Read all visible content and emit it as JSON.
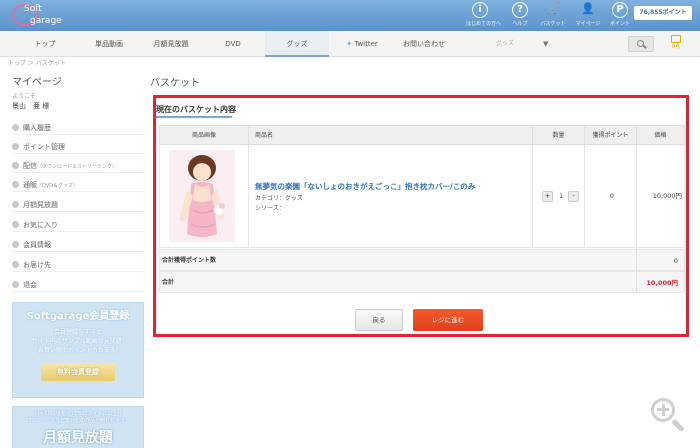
{
  "header": {
    "logo_top": "Soft",
    "logo_bottom": "garage",
    "icons": [
      {
        "name": "guide-icon",
        "symbol": "i",
        "label": "はじめての方へ"
      },
      {
        "name": "help-icon",
        "symbol": "?",
        "label": "ヘルプ"
      },
      {
        "name": "cart-icon",
        "symbol": "🛒",
        "label": "バスケット"
      },
      {
        "name": "mypage-icon",
        "symbol": "👤",
        "label": "マイページ"
      },
      {
        "name": "point-icon",
        "symbol": "P",
        "label": "ポイント"
      }
    ],
    "points_display": "76,855ポイント"
  },
  "nav": {
    "items": [
      "トップ",
      "単品動画",
      "月額見放題",
      "DVD",
      "グッズ",
      "Twitter",
      "お問い合わせ"
    ],
    "search_category": "グッズ",
    "cart_mini_label": "0点"
  },
  "breadcrumb": "トップ ＞ バスケット",
  "sidebar": {
    "title": "マイページ",
    "user_label": "ようこそ",
    "user_name": "景山　亜 様",
    "items": [
      {
        "label": "購入履歴",
        "sub": ""
      },
      {
        "label": "ポイント管理",
        "sub": ""
      },
      {
        "label": "配信",
        "sub": "（ダウンロード＆ストリーミング）"
      },
      {
        "label": "通販",
        "sub": "（DVD＆グッズ）"
      },
      {
        "label": "月額見放題",
        "sub": ""
      },
      {
        "label": "お気に入り",
        "sub": ""
      },
      {
        "label": "会員情報",
        "sub": ""
      },
      {
        "label": "お届け先",
        "sub": ""
      },
      {
        "label": "退会",
        "sub": ""
      }
    ],
    "banner1": {
      "title": "Softgarage会員登録",
      "text_line1": "会員登録をすると",
      "text_line2": "サイト内のサンプル動画が見放題!",
      "text_line3": "お買い物でポイントもたまる!",
      "button": "無料会員登録"
    },
    "banner2": {
      "text_line1": "月々500円(税込)で600タイトル以上!!",
      "text_line2": "TVシリーズなど懐かしの作品が観れちゃう!",
      "big": "月額見放題"
    }
  },
  "main": {
    "page_title": "バスケット",
    "section_title": "現在のバスケット内容",
    "columns": [
      "商品画像",
      "商品名",
      "数量",
      "獲得ポイント",
      "価格"
    ],
    "item": {
      "name": "無夢気の楽園「ないしょのおきがえごっこ」抱き枕カバー/このみ",
      "category": "カテゴリ：グッズ",
      "series": "シリーズ：",
      "qty": "1",
      "points": "0",
      "price": "10,000円"
    },
    "total_points_label": "合計獲得ポイント数",
    "total_points_value": "0",
    "total_label": "合計",
    "total_value": "10,000円",
    "back_button": "戻る",
    "checkout_button": "レジに進む"
  },
  "colors": {
    "accent": "#e8212f",
    "link": "#2d74c9",
    "header": "#5b93cc",
    "checkout": "#e0401c"
  }
}
